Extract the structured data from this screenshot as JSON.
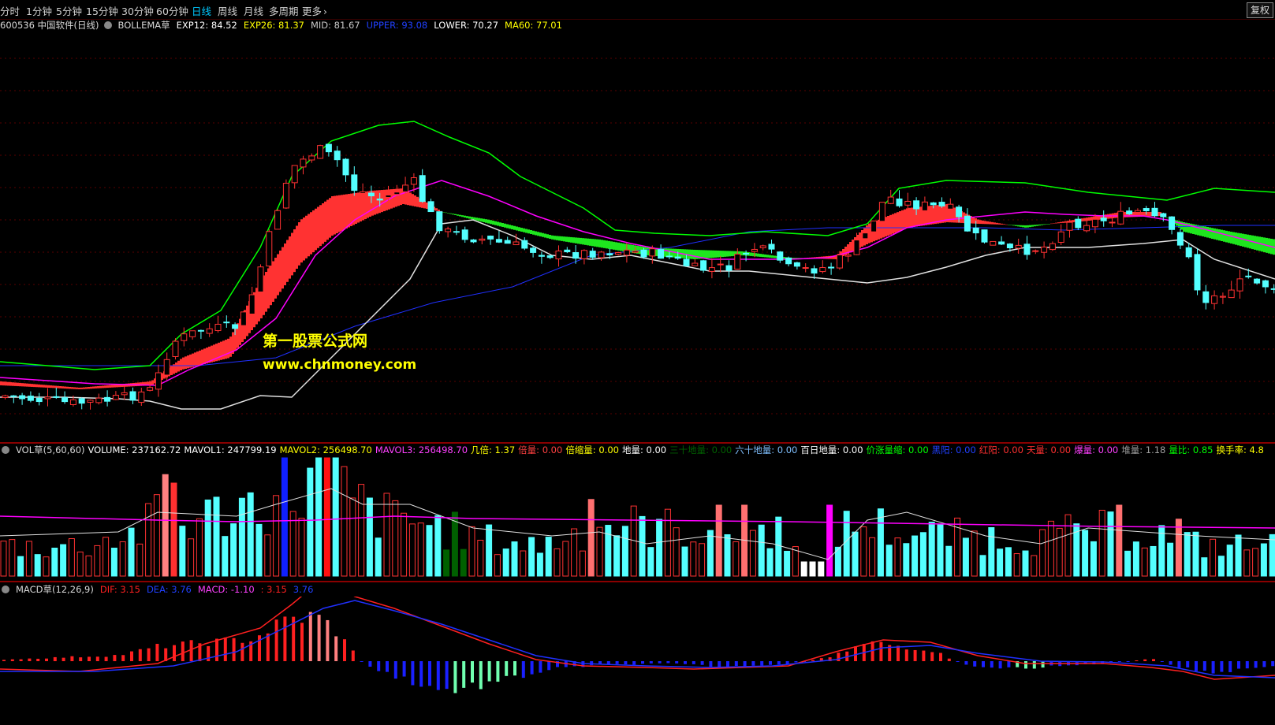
{
  "toolbar": {
    "tabs": [
      "分时",
      "1分钟",
      "5分钟",
      "15分钟",
      "30分钟",
      "60分钟",
      "日线",
      "周线",
      "月线",
      "多周期",
      "更多"
    ],
    "active_tab": "日线",
    "more_arrow": "›",
    "fuquan_label": "复权"
  },
  "main_info": {
    "title": "600536 中国软件(日线)",
    "indicator": "BOLLEMA草",
    "exp12": "EXP12: 84.52",
    "exp26": "EXP26: 81.37",
    "mid": "MID: 81.67",
    "upper": "UPPER: 93.08",
    "lower": "LOWER: 70.27",
    "ma60": "MA60: 77.01"
  },
  "vol_info": {
    "name": "VOL草(5,60,60)",
    "volume": "VOLUME: 237162.72",
    "mavol1": "MAVOL1: 247799.19",
    "mavol2": "MAVOL2: 256498.70",
    "mavol3": "MAVOL3: 256498.70",
    "jibei": "几倍: 1.37",
    "beiliang": "倍量: 0.00",
    "beisuoliang": "倍缩量: 0.00",
    "diliang": "地量: 0.00",
    "sanshi": "三十地量: 0.00",
    "liushi": "六十地量: 0.00",
    "bairi": "百日地量: 0.00",
    "jiazhang": "价涨量缩: 0.00",
    "heiyang": "黑阳: 0.00",
    "hongyang": "红阳: 0.00",
    "tianliang": "天量: 0.00",
    "baoliang": "爆量: 0.00",
    "duiliang": "堆量: 1.18",
    "liangbi": "量比: 0.85",
    "huanshou": "换手率: 4.8"
  },
  "macd_info": {
    "name": "MACD草(12,26,9)",
    "dif": "DIF: 3.15",
    "dea": "DEA: 3.76",
    "macd": "MACD: -1.10",
    "extra1": ": 3.15",
    "extra2": "3.76"
  },
  "watermark": {
    "line1": "第一股票公式网",
    "line2": "www.chnmoney.com"
  },
  "colors": {
    "up": "#ff3232",
    "down": "#54ffff",
    "upper_band": "#00ff00",
    "lower_band": "#e0e0e0",
    "mid_line": "#ff00ff",
    "ma60": "#2030ff",
    "dif": "#ff2020",
    "dea": "#2030ff"
  }
}
